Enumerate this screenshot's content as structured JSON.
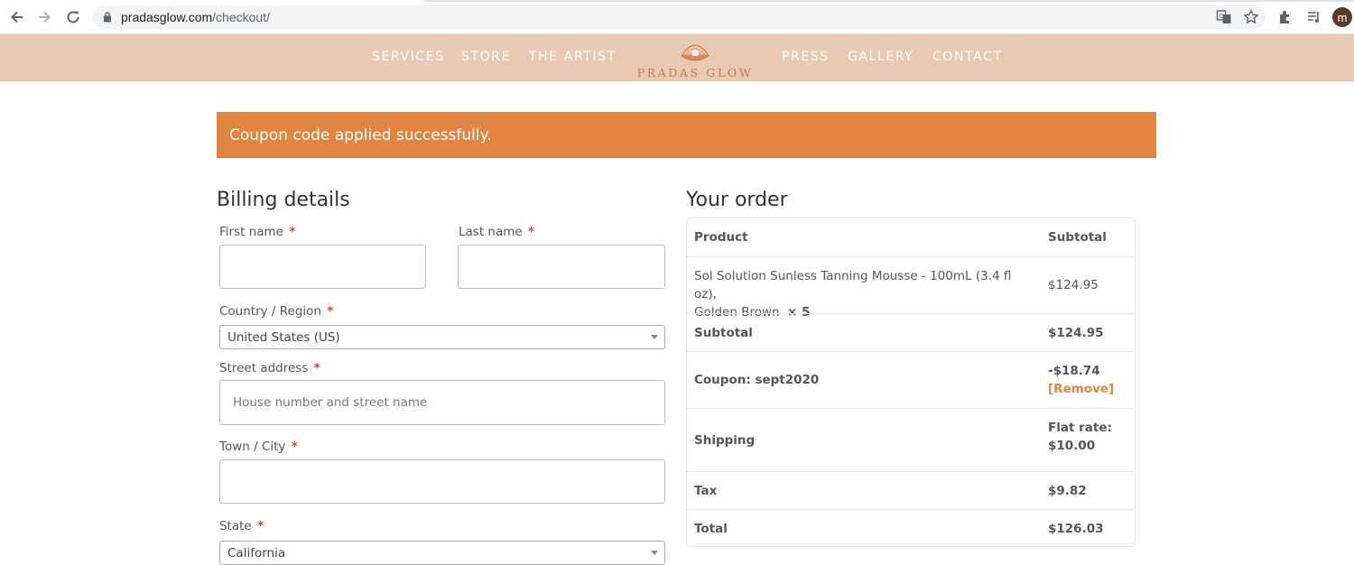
{
  "browser": {
    "url_host": "pradasglow.com",
    "url_path": "/checkout/",
    "profile_initial": "m"
  },
  "site": {
    "brand": "PRADAS GLOW",
    "menu_left": [
      "SERVICES",
      "STORE",
      "THE ARTIST"
    ],
    "menu_right": [
      "PRESS",
      "GALLERY",
      "CONTACT"
    ]
  },
  "notice": {
    "message": "Coupon code applied successfully."
  },
  "billing": {
    "title": "Billing details",
    "required_marker": "*",
    "first_name_label": "First name",
    "first_name_value": "",
    "last_name_label": "Last name",
    "last_name_value": "",
    "country_label": "Country / Region",
    "country_value": "United States (US)",
    "street_label": "Street address",
    "street_placeholder": "House number and street name",
    "city_label": "Town / City",
    "city_value": "",
    "state_label": "State",
    "state_value": "California"
  },
  "order": {
    "title": "Your order",
    "col_product": "Product",
    "col_subtotal": "Subtotal",
    "item_name_line1": "Sol Solution Sunless Tanning Mousse - 100mL (3.4 fl oz),",
    "item_name_line2": "Golden Brown",
    "item_qty": "× 5",
    "item_price": "$124.95",
    "subtotal_label": "Subtotal",
    "subtotal_value": "$124.95",
    "coupon_label": "Coupon: sept2020",
    "coupon_value": "-$18.74",
    "coupon_remove": "[Remove]",
    "shipping_label": "Shipping",
    "shipping_value_line1": "Flat rate:",
    "shipping_value_line2": "$10.00",
    "tax_label": "Tax",
    "tax_value": "$9.82",
    "total_label": "Total",
    "total_value": "$126.03"
  },
  "colors": {
    "header_bg": "#e8c9b3",
    "notice_bg": "#e08642",
    "required": "#e2401c",
    "brand": "#c07a55"
  }
}
